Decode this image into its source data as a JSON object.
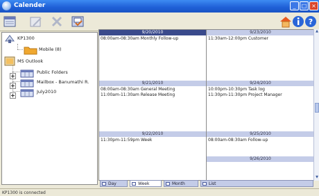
{
  "window": {
    "title": "Calender"
  },
  "toolbar": {
    "left_icons": [
      "calendar-icon",
      "edit-icon",
      "delete-icon",
      "save-icon"
    ],
    "right_icons": [
      "home-icon",
      "info-icon",
      "help-icon"
    ]
  },
  "tree": {
    "items": [
      {
        "label": "KP1300",
        "icon": "phone-icon"
      },
      {
        "label": "Mobile (8)",
        "icon": "folder-icon"
      },
      {
        "label": "MS Outlook",
        "icon": "outlook-icon"
      },
      {
        "label": "Public Folders",
        "icon": "calendar-folder-icon"
      },
      {
        "label": "Mailbox - Banumathi R.",
        "icon": "calendar-folder-icon"
      },
      {
        "label": "July2010",
        "icon": "calendar-folder-icon"
      }
    ]
  },
  "calendar": {
    "days": [
      {
        "date": "9/20/2010",
        "selected": true,
        "appointments": [
          "08:00am-08:30am Monthly Follow-up"
        ]
      },
      {
        "date": "9/21/2010",
        "selected": false,
        "appointments": [
          "08:00am-08:30am General Meeting",
          "11:00am-11:30am Release Meeting"
        ]
      },
      {
        "date": "9/22/2010",
        "selected": false,
        "appointments": [
          "11:30pm-11:59pm Week"
        ]
      },
      {
        "date": "9/23/2010",
        "selected": false,
        "appointments": [
          "11:30am-12:00pm Customer"
        ]
      },
      {
        "date": "9/24/2010",
        "selected": false,
        "appointments": [
          "10:00pm-10:30pm Task log",
          "11:30pm-11:30pm Project Manager"
        ]
      },
      {
        "date": "9/25/2010",
        "selected": false,
        "appointments": [
          "08:00am-08:30am Follow-up"
        ]
      },
      {
        "date": "9/26/2010",
        "selected": false,
        "appointments": []
      }
    ]
  },
  "view_tabs": [
    {
      "label": "Day",
      "active": false
    },
    {
      "label": "Week",
      "active": true
    },
    {
      "label": "Month",
      "active": false
    },
    {
      "label": "List",
      "active": false
    }
  ],
  "status": {
    "text": "KP1300 is connected"
  },
  "colors": {
    "title_bar": "#1e5fd6",
    "selected_day": "#3a4a8c",
    "day_header": "#c4cce8"
  }
}
